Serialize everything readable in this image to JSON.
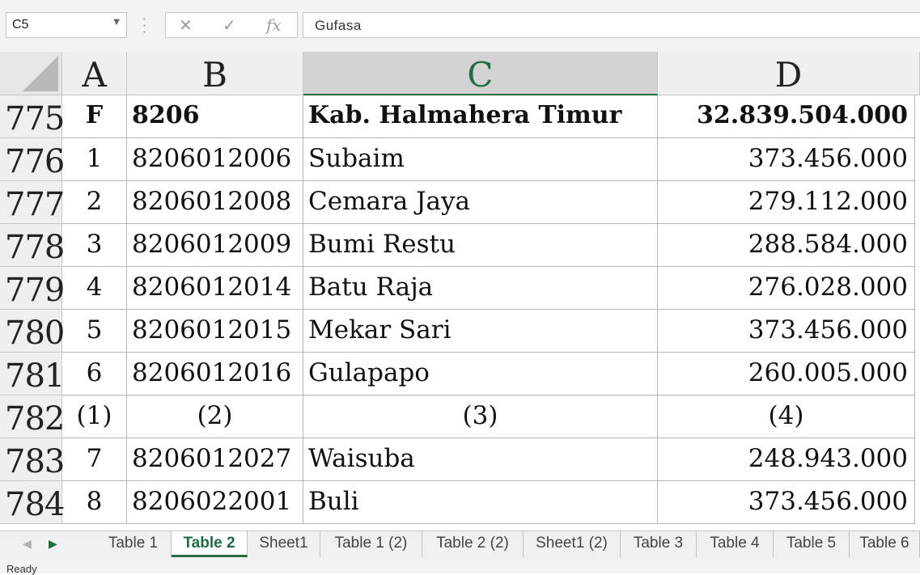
{
  "formula_bar": {
    "name_box": "C5",
    "cancel_glyph": "✕",
    "enter_glyph": "✓",
    "fx_glyph": "fx",
    "formula": "Gufasa"
  },
  "columns": [
    "A",
    "B",
    "C",
    "D"
  ],
  "active_column": "C",
  "rows": [
    {
      "num": "775",
      "a": "F",
      "b": "8206",
      "c": "Kab.  Halmahera  Timur",
      "d": "32.839.504.000",
      "bold": true
    },
    {
      "num": "776",
      "a": "1",
      "b": "8206012006",
      "c": "Subaim",
      "d": "373.456.000"
    },
    {
      "num": "777",
      "a": "2",
      "b": "8206012008",
      "c": "Cemara Jaya",
      "d": "279.112.000"
    },
    {
      "num": "778",
      "a": "3",
      "b": "8206012009",
      "c": "Bumi Restu",
      "d": "288.584.000"
    },
    {
      "num": "779",
      "a": "4",
      "b": "8206012014",
      "c": "Batu Raja",
      "d": "276.028.000"
    },
    {
      "num": "780",
      "a": "5",
      "b": "8206012015",
      "c": "Mekar Sari",
      "d": "373.456.000"
    },
    {
      "num": "781",
      "a": "6",
      "b": "8206012016",
      "c": "Gulapapo",
      "d": "260.005.000"
    },
    {
      "num": "782",
      "a": "(1)",
      "b": "(2)",
      "c": "(3)",
      "d": "(4)",
      "header_row": true
    },
    {
      "num": "783",
      "a": "7",
      "b": "8206012027",
      "c": "Waisuba",
      "d": "248.943.000"
    },
    {
      "num": "784",
      "a": "8",
      "b": "8206022001",
      "c": "Buli",
      "d": "373.456.000"
    }
  ],
  "sheet_tabs": [
    "Table 1",
    "Table 2",
    "Sheet1",
    "Table 1 (2)",
    "Table 2 (2)",
    "Sheet1 (2)",
    "Table 3",
    "Table 4",
    "Table 5",
    "Table 6"
  ],
  "active_tab": "Table 2",
  "status": "Ready",
  "colors": {
    "accent": "#1f6b43",
    "header_bg": "#efefef",
    "active_header_bg": "#d3d3d3"
  }
}
